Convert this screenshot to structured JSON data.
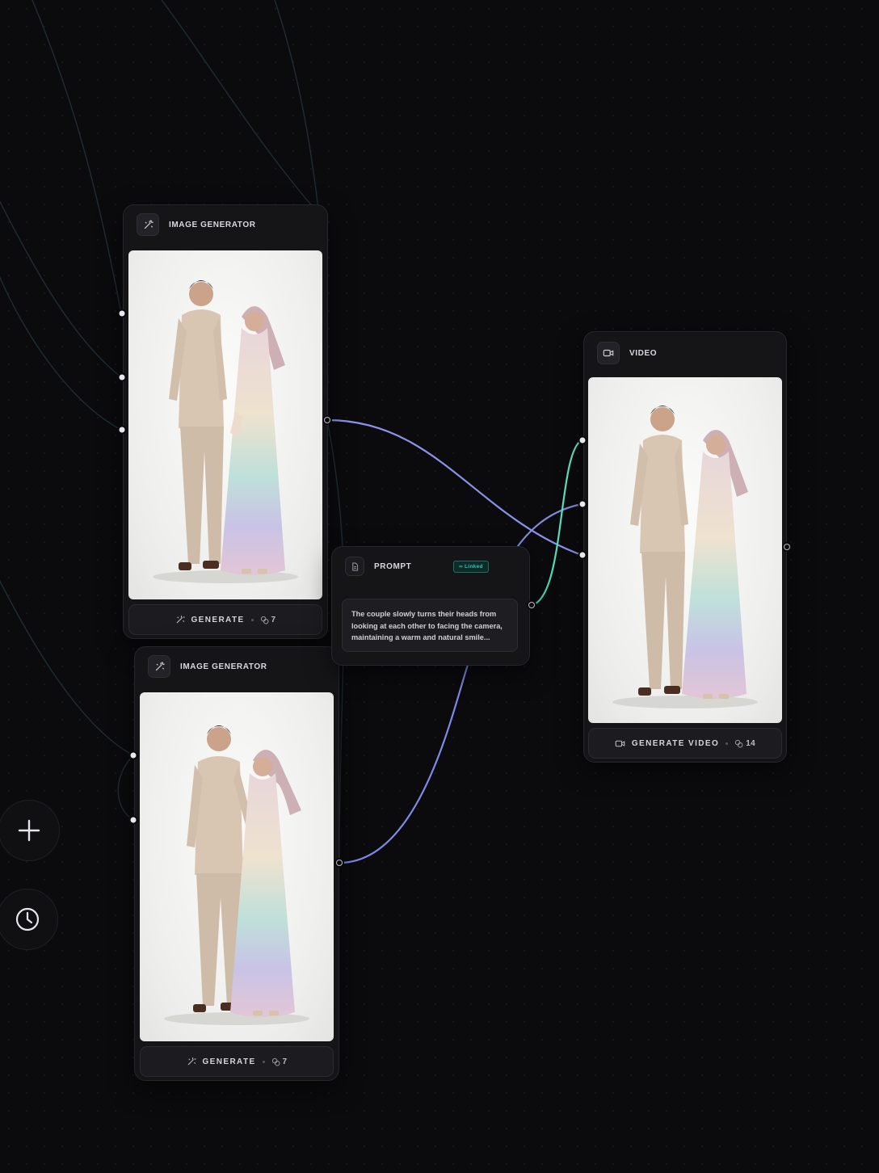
{
  "nodes": {
    "image_gen_1": {
      "title": "IMAGE GENERATOR",
      "button_label": "GENERATE",
      "credits": "7"
    },
    "image_gen_2": {
      "title": "IMAGE GENERATOR",
      "button_label": "GENERATE",
      "credits": "7"
    },
    "prompt": {
      "title": "PROMPT",
      "badge": "∞ Linked",
      "text": "The couple slowly turns their heads from looking at each other to facing the camera, maintaining a warm and natural smile..."
    },
    "video": {
      "title": "VIDEO",
      "button_label": "GENERATE VIDEO",
      "credits": "14"
    }
  },
  "colors": {
    "canvas": "#0b0b0e",
    "node": "#151518",
    "wire_image": "#8a93e8",
    "wire_prompt": "#3fd7b0",
    "wire_faint": "#2a3540"
  },
  "icons": {
    "image_gen": "magic-wand-icon",
    "prompt": "document-icon",
    "video": "video-camera-icon",
    "credits": "coins-icon",
    "add": "plus-icon",
    "history": "clock-icon"
  }
}
